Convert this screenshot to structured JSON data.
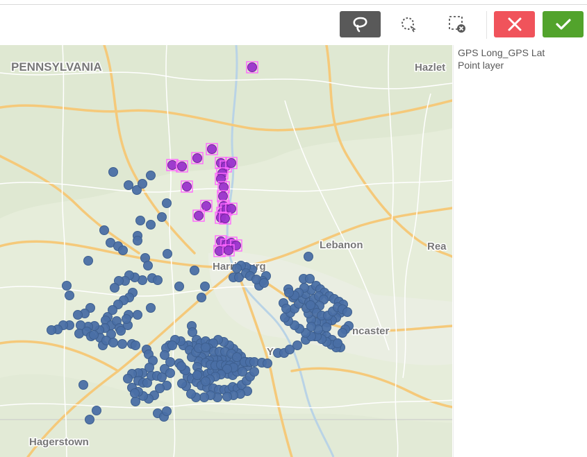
{
  "toolbar": {
    "lasso_tool": "lasso-icon",
    "circle_select_tool": "circle-select-icon",
    "clear_selection_tool": "clear-selection-icon",
    "cancel": "close-icon",
    "confirm": "check-icon",
    "colors": {
      "lasso_bg": "#595959",
      "cancel_bg": "#f0535b",
      "confirm_bg": "#52a32c"
    }
  },
  "legend": {
    "title": "GPS Long_GPS Lat",
    "subtitle": "Point layer"
  },
  "map": {
    "labels": {
      "state": "PENNSYLVANIA",
      "hazleton": "Hazlet",
      "lebanon": "Lebanon",
      "reading": "Rea",
      "harrisburg": "Harrisburg",
      "lancaster": "ncaster",
      "york": "Y",
      "hagerstown": "Hagerstown"
    },
    "colors": {
      "point": "#4a6fa5",
      "point_selected": "#9a33cc",
      "selection_outline": "#ff66ff",
      "highway": "#f5c97a",
      "road": "#ffffff"
    }
  }
}
